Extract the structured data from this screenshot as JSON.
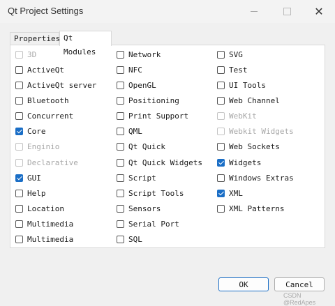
{
  "window": {
    "title": "Qt Project Settings"
  },
  "tabs": [
    {
      "label": "Properties",
      "selected": false
    },
    {
      "label": "Qt Modules",
      "selected": true
    }
  ],
  "modules": {
    "col1": [
      {
        "label": "3D",
        "checked": false,
        "disabled": true
      },
      {
        "label": "ActiveQt",
        "checked": false,
        "disabled": false
      },
      {
        "label": "ActiveQt server",
        "checked": false,
        "disabled": false
      },
      {
        "label": "Bluetooth",
        "checked": false,
        "disabled": false
      },
      {
        "label": "Concurrent",
        "checked": false,
        "disabled": false
      },
      {
        "label": "Core",
        "checked": true,
        "disabled": false
      },
      {
        "label": "Enginio",
        "checked": false,
        "disabled": true
      },
      {
        "label": "Declarative",
        "checked": false,
        "disabled": true
      },
      {
        "label": "GUI",
        "checked": true,
        "disabled": false
      },
      {
        "label": "Help",
        "checked": false,
        "disabled": false
      },
      {
        "label": "Location",
        "checked": false,
        "disabled": false
      },
      {
        "label": "Multimedia",
        "checked": false,
        "disabled": false
      },
      {
        "label": "Multimedia",
        "checked": false,
        "disabled": false
      }
    ],
    "col2": [
      {
        "label": "Network",
        "checked": false,
        "disabled": false
      },
      {
        "label": "NFC",
        "checked": false,
        "disabled": false
      },
      {
        "label": "OpenGL",
        "checked": false,
        "disabled": false
      },
      {
        "label": "Positioning",
        "checked": false,
        "disabled": false
      },
      {
        "label": "Print Support",
        "checked": false,
        "disabled": false
      },
      {
        "label": "QML",
        "checked": false,
        "disabled": false
      },
      {
        "label": "Qt Quick",
        "checked": false,
        "disabled": false
      },
      {
        "label": "Qt Quick Widgets",
        "checked": false,
        "disabled": false
      },
      {
        "label": "Script",
        "checked": false,
        "disabled": false
      },
      {
        "label": "Script Tools",
        "checked": false,
        "disabled": false
      },
      {
        "label": "Sensors",
        "checked": false,
        "disabled": false
      },
      {
        "label": "Serial Port",
        "checked": false,
        "disabled": false
      },
      {
        "label": "SQL",
        "checked": false,
        "disabled": false
      }
    ],
    "col3": [
      {
        "label": "SVG",
        "checked": false,
        "disabled": false
      },
      {
        "label": "Test",
        "checked": false,
        "disabled": false
      },
      {
        "label": "UI Tools",
        "checked": false,
        "disabled": false
      },
      {
        "label": "Web Channel",
        "checked": false,
        "disabled": false
      },
      {
        "label": "WebKit",
        "checked": false,
        "disabled": true
      },
      {
        "label": "Webkit Widgets",
        "checked": false,
        "disabled": true
      },
      {
        "label": "Web Sockets",
        "checked": false,
        "disabled": false
      },
      {
        "label": "Widgets",
        "checked": true,
        "disabled": false
      },
      {
        "label": "Windows Extras",
        "checked": false,
        "disabled": false
      },
      {
        "label": "XML",
        "checked": true,
        "disabled": false
      },
      {
        "label": "XML Patterns",
        "checked": false,
        "disabled": false
      }
    ]
  },
  "buttons": {
    "ok": "OK",
    "cancel": "Cancel"
  },
  "watermark": "CSDN @RedApes",
  "colors": {
    "accent": "#1a6ec6",
    "disabled_text": "#a8a8a8"
  }
}
